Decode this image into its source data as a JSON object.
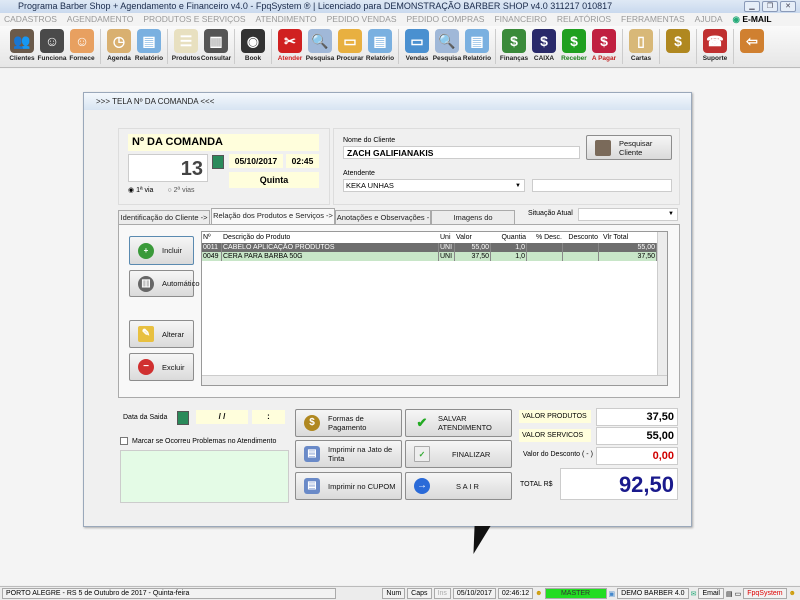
{
  "window": {
    "title": "Programa Barber Shop + Agendamento e Financeiro v4.0 - FpqSystem ® | Licenciado para  DEMONSTRAÇÃO BARBER SHOP v4.0 311217 010817"
  },
  "menu": [
    "CADASTROS",
    "AGENDAMENTO",
    "PRODUTOS E SERVIÇOS",
    "ATENDIMENTO",
    "PEDIDO VENDAS",
    "PEDIDO COMPRAS",
    "FINANCEIRO",
    "RELATÓRIOS",
    "FERRAMENTAS",
    "AJUDA"
  ],
  "menu_email": "E-MAIL",
  "toolbar": [
    {
      "label": "Clientes",
      "icon": "clients-icon",
      "color": "#6b5a4a",
      "glyph": "👥"
    },
    {
      "label": "Funciona",
      "icon": "employee-icon",
      "color": "#4a4a4a",
      "glyph": "☺"
    },
    {
      "label": "Fornece",
      "icon": "supplier-icon",
      "color": "#e8a060",
      "glyph": "☺"
    },
    {
      "sep": true
    },
    {
      "label": "Agenda",
      "icon": "agenda-icon",
      "color": "#d9b070",
      "glyph": "◷"
    },
    {
      "label": "Relatório",
      "icon": "printer-icon",
      "color": "#7ab0e0",
      "glyph": "▤"
    },
    {
      "sep": true
    },
    {
      "label": "Produtos",
      "icon": "products-icon",
      "color": "#e8e0c0",
      "glyph": "☰"
    },
    {
      "label": "Consultar",
      "icon": "barcode-icon",
      "color": "#555",
      "glyph": "▥"
    },
    {
      "sep": true
    },
    {
      "label": "Book",
      "icon": "camera-icon",
      "color": "#333",
      "glyph": "◉"
    },
    {
      "sep": true
    },
    {
      "label": "Atender",
      "icon": "scissors-icon",
      "color": "#d02020",
      "glyph": "✂"
    },
    {
      "label": "Pesquisa",
      "icon": "search-docs-icon",
      "color": "#a0b8d8",
      "glyph": "🔍"
    },
    {
      "label": "Procurar",
      "icon": "folder-icon",
      "color": "#e8b040",
      "glyph": "▭"
    },
    {
      "label": "Relatório",
      "icon": "printer-icon",
      "color": "#7ab0e0",
      "glyph": "▤"
    },
    {
      "sep": true
    },
    {
      "label": "Vendas",
      "icon": "monitor-icon",
      "color": "#4a90d0",
      "glyph": "▭"
    },
    {
      "label": "Pesquisa",
      "icon": "search-docs-icon",
      "color": "#a0b8d8",
      "glyph": "🔍"
    },
    {
      "label": "Relatório",
      "icon": "printer-icon",
      "color": "#7ab0e0",
      "glyph": "▤"
    },
    {
      "sep": true
    },
    {
      "label": "Finanças",
      "icon": "finance-icon",
      "color": "#3a8a3a",
      "glyph": "$"
    },
    {
      "label": "CAIXA",
      "icon": "cashbook-icon",
      "color": "#2a2a6a",
      "glyph": "$"
    },
    {
      "label": "Receber",
      "icon": "receive-dollar-icon",
      "color": "#20a020",
      "glyph": "$"
    },
    {
      "label": "A Pagar",
      "icon": "pay-dollar-icon",
      "color": "#c02040",
      "glyph": "$"
    },
    {
      "sep": true
    },
    {
      "label": "Cartas",
      "icon": "scroll-icon",
      "color": "#d8b878",
      "glyph": "▯"
    },
    {
      "sep": true
    },
    {
      "label": "",
      "icon": "coins-icon",
      "color": "#b08820",
      "glyph": "$"
    },
    {
      "sep": true
    },
    {
      "label": "Suporte",
      "icon": "support-icon",
      "color": "#c03030",
      "glyph": "☎"
    },
    {
      "sep": true
    },
    {
      "label": "",
      "icon": "exit-door-icon",
      "color": "#d08030",
      "glyph": "⇦"
    }
  ],
  "dialog": {
    "title": ">>>   TELA Nº DA COMANDA   <<<",
    "comanda_label": "Nº DA COMANDA",
    "comanda_number": "13",
    "date": "05/10/2017",
    "time": "02:45",
    "weekday": "Quinta",
    "via1": "1ª via",
    "via2": "2ª vias",
    "client_label": "Nome do Cliente",
    "client_name": "ZACH GALIFIANAKIS",
    "search_client": "Pesquisar Cliente",
    "attendant_label": "Atendente",
    "attendant": "KEKA UNHAS",
    "attendant_extra": "",
    "tabs": [
      "Identificação do Cliente ->",
      "Relação dos Produtos e Serviços ->",
      "Anotações e Observações ->",
      "Imagens do Atendimento"
    ],
    "situacao_label": "Situação Atual",
    "situacao": "",
    "side_buttons": {
      "incluir": "Incluir",
      "automatico": "Automático",
      "alterar": "Alterar",
      "excluir": "Excluir"
    },
    "grid": {
      "headers": [
        "Nº",
        "Descrição do Produto",
        "Uni",
        "Valor",
        "Quantia",
        "% Desc.",
        "Desconto",
        "Vlr Total"
      ],
      "rows": [
        [
          "0011",
          "CABELO APLICAÇÃO PRODUTOS",
          "UNI",
          "55,00",
          "1,0",
          "",
          "",
          "55,00"
        ],
        [
          "0049",
          "CERA PARA BARBA 50G",
          "UNI",
          "37,50",
          "1,0",
          "",
          "",
          "37,50"
        ]
      ]
    },
    "exit_date_label": "Data da Saida",
    "exit_date": " / /",
    "exit_time": ":",
    "problem_check": "Marcar se Ocorreu Problemas no Atendimento",
    "problem_notes": "",
    "btn_pagamento": "Formas de Pagamento",
    "btn_salvar": "SALVAR  ATENDIMENTO",
    "btn_jato": "Imprimir na Jato de Tinta",
    "btn_finalizar": "FINALIZAR",
    "btn_cupom": "Imprimir no CUPOM",
    "btn_sair": "S A I R",
    "valor_produtos_label": "VALOR PRODUTOS",
    "valor_produtos": "37,50",
    "valor_servicos_label": "VALOR SERVICOS",
    "valor_servicos": "55,00",
    "desconto_label": "Valor do Desconto ( - )",
    "desconto": "0,00",
    "total_label": "TOTAL R$",
    "total": "92,50"
  },
  "status": {
    "location": "PORTO ALEGRE - RS  5 de Outubro de 2017 - Quinta-feira",
    "num": "Num",
    "caps": "Caps",
    "ins": "Ins",
    "date": "05/10/2017",
    "time": "02:46:12",
    "user": "MASTER",
    "version": "DEMO BARBER 4.0",
    "email": "Email",
    "brand": "FpqSystem"
  },
  "colors": {
    "selected_row": "#6e6e6e",
    "row_green": "#c8e6c8",
    "total_blue": "#1a1a8c",
    "discount_red": "#d00000",
    "master_green": "#22dd22"
  }
}
